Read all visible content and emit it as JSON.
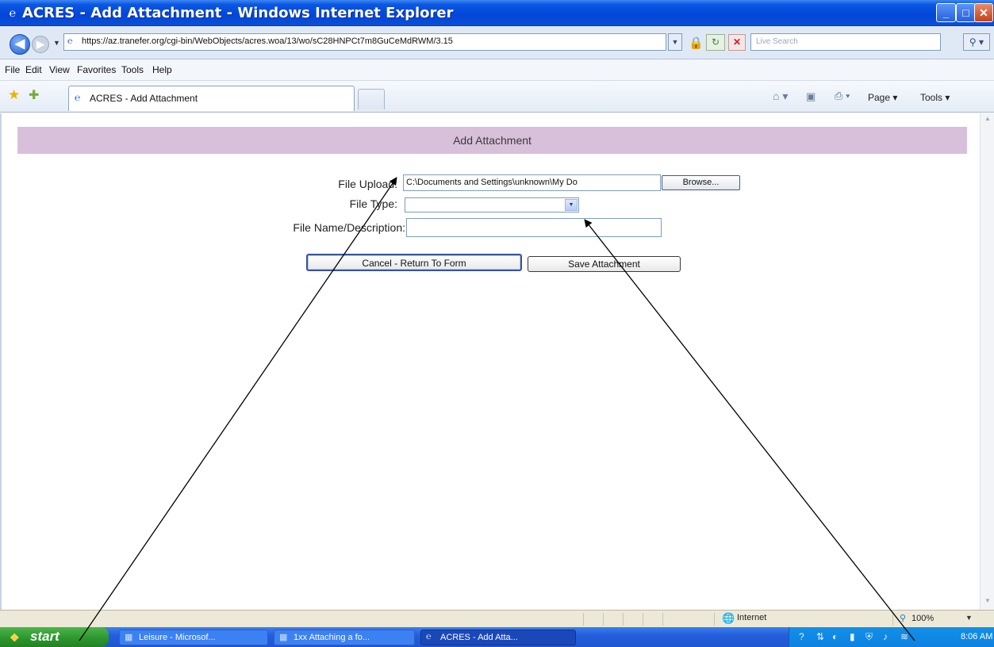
{
  "window": {
    "title": "ACRES - Add Attachment - Windows Internet Explorer",
    "minimize": "_",
    "maximize": "□",
    "close": "✕"
  },
  "address_bar": {
    "url": "https://az.tranefer.org/cgi-bin/WebObjects/acres.woa/13/wo/sC28HNPCt7m8GuCeMdRWM/3.15",
    "search_placeholder": "Live Search"
  },
  "menu": [
    "File",
    "Edit",
    "View",
    "Favorites",
    "Tools",
    "Help"
  ],
  "tab": {
    "label": "ACRES - Add Attachment"
  },
  "command_bar": {
    "page": "Page ▾",
    "tools": "Tools ▾"
  },
  "form": {
    "header": "Add Attachment",
    "file_upload_label": "File Upload:",
    "file_upload_value": "C:\\Documents and Settings\\unknown\\My Do",
    "browse_label": "Browse...",
    "file_type_label": "File Type:",
    "file_type_value": "",
    "file_name_label": "File Name/Description:",
    "file_name_value": "",
    "cancel_label": "Cancel - Return To Form",
    "save_label": "Save Attachment"
  },
  "status_bar": {
    "zone": "Internet",
    "zoom": "100%"
  },
  "taskbar": {
    "start": "start",
    "items": [
      {
        "label": "Leisure - Microsof...",
        "active": false
      },
      {
        "label": "1xx Attaching a fo...",
        "active": false
      },
      {
        "label": "ACRES - Add Atta...",
        "active": true
      }
    ],
    "clock": "8:06 AM"
  },
  "colors": {
    "title_bar": "#0346d8",
    "header_band": "#d8c0da",
    "taskbar": "#245edc",
    "start_button": "#2e962e"
  },
  "icons": [
    "ie-icon",
    "back-icon",
    "forward-icon",
    "lock-icon",
    "refresh-icon",
    "stop-icon",
    "search-icon",
    "star-icon",
    "home-icon",
    "print-icon",
    "globe-icon",
    "windows-logo-icon"
  ]
}
